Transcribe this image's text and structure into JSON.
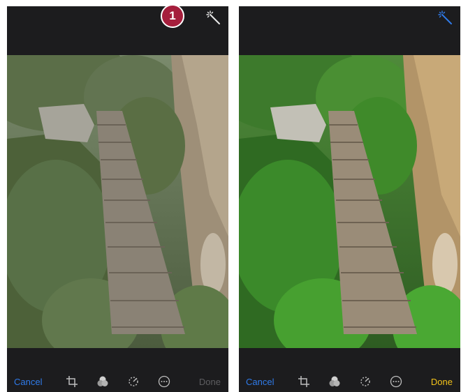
{
  "screens": [
    {
      "toolbar": {
        "cancel_label": "Cancel",
        "done_label": "Done",
        "done_state": "disabled"
      },
      "auto_enhance_icon": "magic-wand-icon",
      "auto_enhance_active": false
    },
    {
      "toolbar": {
        "cancel_label": "Cancel",
        "done_label": "Done",
        "done_state": "enabled"
      },
      "auto_enhance_icon": "magic-wand-icon",
      "auto_enhance_active": true
    }
  ],
  "callout": {
    "number": "1"
  },
  "toolbar_icons": [
    "crop-rotate-icon",
    "filters-icon",
    "adjust-dial-icon",
    "more-icon"
  ],
  "colors": {
    "background": "#1c1c1e",
    "accent_blue": "#2f7bea",
    "done_enabled": "#f2c21a",
    "done_disabled": "#5d5d60",
    "callout": "#a51e3c"
  }
}
